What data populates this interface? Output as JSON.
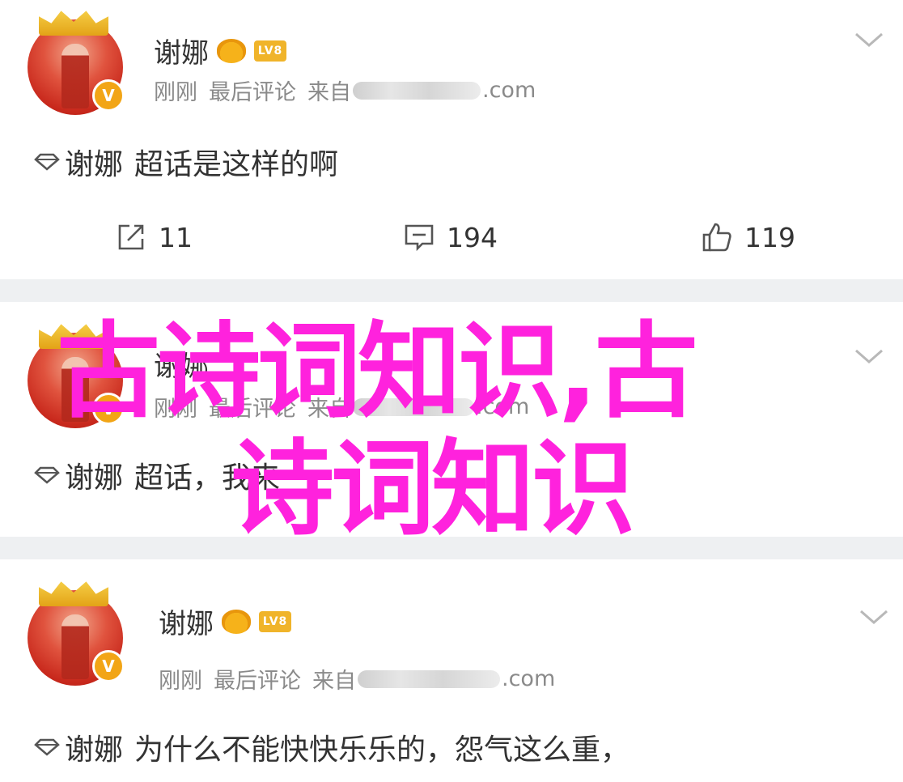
{
  "posts": [
    {
      "username": "谢娜",
      "badge_level": "LV8",
      "badge_vip": "V",
      "time": "刚刚",
      "action": "最后评论",
      "source_prefix": "来自",
      "source_suffix": ".com",
      "topic": "谢娜",
      "content": "超话是这样的啊",
      "counts": {
        "repost": "11",
        "comment": "194",
        "like": "119"
      }
    },
    {
      "username": "谢娜",
      "time": "刚刚",
      "action": "最后评论",
      "source_prefix": "来自",
      "source_suffix": ".com",
      "topic": "谢娜",
      "content": "超话，我来"
    },
    {
      "username": "谢娜",
      "badge_level": "LV8",
      "time": "刚刚",
      "action": "最后评论",
      "source_prefix": "来自",
      "source_suffix": ".com",
      "topic": "谢娜",
      "content": "为什么不能快快乐乐的，怨气这么重，"
    }
  ],
  "overlay": {
    "line1": "古诗词知识,古",
    "line2": "诗词知识"
  },
  "colors": {
    "overlay": "#ff22dd",
    "text": "#333333",
    "meta": "#8a8a8a",
    "gap": "#eef0f2",
    "vip_badge": "#f2a516"
  },
  "icons": {
    "repost": "repost-icon",
    "comment": "comment-icon",
    "like": "thumbs-up-icon",
    "topic": "supertopic-diamond-icon",
    "more": "chevron-down-icon"
  }
}
